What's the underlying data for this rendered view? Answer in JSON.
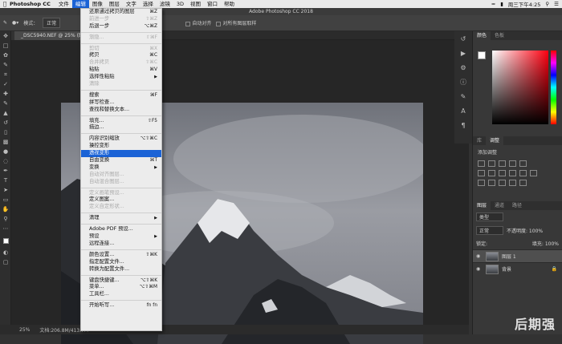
{
  "menubar": {
    "app": "Photoshop CC",
    "items": [
      "文件",
      "编辑",
      "图像",
      "图层",
      "文字",
      "选择",
      "滤镜",
      "3D",
      "视图",
      "窗口",
      "帮助"
    ],
    "active_index": 1,
    "clock": "周三下午4:25"
  },
  "titlebar": {
    "title": "Adobe Photoshop CC 2018"
  },
  "options": {
    "mode_label": "模式：",
    "mode_value": "正常",
    "align_label": "自动对齐",
    "sample_label": "对所有图层取样"
  },
  "doc_tab": {
    "label": "_DSC5940.NEF @ 25% (图层 1, RGB/8*)"
  },
  "status": {
    "zoom": "25%",
    "doc": "文档:206.8M/413.7M"
  },
  "edit_menu": [
    {
      "label": "还原通过拷贝的图层",
      "shortcut": "⌘Z",
      "enabled": true
    },
    {
      "label": "前进一步",
      "shortcut": "⇧⌘Z",
      "enabled": false
    },
    {
      "label": "后退一步",
      "shortcut": "⌥⌘Z",
      "enabled": true
    },
    {
      "sep": true
    },
    {
      "label": "渐隐...",
      "shortcut": "⇧⌘F",
      "enabled": false
    },
    {
      "sep": true
    },
    {
      "label": "剪切",
      "shortcut": "⌘X",
      "enabled": false
    },
    {
      "label": "拷贝",
      "shortcut": "⌘C",
      "enabled": true
    },
    {
      "label": "合并拷贝",
      "shortcut": "⇧⌘C",
      "enabled": false
    },
    {
      "label": "粘贴",
      "shortcut": "⌘V",
      "enabled": true
    },
    {
      "label": "选择性粘贴",
      "shortcut": "",
      "submenu": true,
      "enabled": true
    },
    {
      "label": "清除",
      "shortcut": "",
      "enabled": false
    },
    {
      "sep": true
    },
    {
      "label": "搜索",
      "shortcut": "⌘F",
      "enabled": true
    },
    {
      "label": "拼写检查...",
      "shortcut": "",
      "enabled": true
    },
    {
      "label": "查找和替换文本...",
      "shortcut": "",
      "enabled": true
    },
    {
      "sep": true
    },
    {
      "label": "填充...",
      "shortcut": "⇧F5",
      "enabled": true
    },
    {
      "label": "描边...",
      "shortcut": "",
      "enabled": true
    },
    {
      "sep": true
    },
    {
      "label": "内容识别缩放",
      "shortcut": "⌥⇧⌘C",
      "enabled": true
    },
    {
      "label": "操控变形",
      "shortcut": "",
      "enabled": true
    },
    {
      "label": "透视变形",
      "shortcut": "",
      "enabled": true,
      "highlight": true
    },
    {
      "label": "自由变换",
      "shortcut": "⌘T",
      "enabled": true
    },
    {
      "label": "变换",
      "shortcut": "",
      "submenu": true,
      "enabled": true
    },
    {
      "label": "自动对齐图层...",
      "shortcut": "",
      "enabled": false
    },
    {
      "label": "自动混合图层...",
      "shortcut": "",
      "enabled": false
    },
    {
      "sep": true
    },
    {
      "label": "定义画笔预设...",
      "shortcut": "",
      "enabled": false
    },
    {
      "label": "定义图案...",
      "shortcut": "",
      "enabled": true
    },
    {
      "label": "定义自定形状...",
      "shortcut": "",
      "enabled": false
    },
    {
      "sep": true
    },
    {
      "label": "清理",
      "shortcut": "",
      "submenu": true,
      "enabled": true
    },
    {
      "sep": true
    },
    {
      "label": "Adobe PDF 预设...",
      "shortcut": "",
      "enabled": true
    },
    {
      "label": "预设",
      "shortcut": "",
      "submenu": true,
      "enabled": true
    },
    {
      "label": "远程连接...",
      "shortcut": "",
      "enabled": true
    },
    {
      "sep": true
    },
    {
      "label": "颜色设置...",
      "shortcut": "⇧⌘K",
      "enabled": true
    },
    {
      "label": "指定配置文件...",
      "shortcut": "",
      "enabled": true
    },
    {
      "label": "转换为配置文件...",
      "shortcut": "",
      "enabled": true
    },
    {
      "sep": true
    },
    {
      "label": "键盘快捷键...",
      "shortcut": "⌥⇧⌘K",
      "enabled": true
    },
    {
      "label": "菜单...",
      "shortcut": "⌥⇧⌘M",
      "enabled": true
    },
    {
      "label": "工具栏...",
      "shortcut": "",
      "enabled": true
    },
    {
      "sep": true
    },
    {
      "label": "开始听写...",
      "shortcut": "fn fn",
      "enabled": true
    }
  ],
  "panels": {
    "color_tabs": [
      "颜色",
      "色板"
    ],
    "adj_tabs": [
      "库",
      "调整"
    ],
    "adj_label": "添加调整",
    "layer_tabs": [
      "图层",
      "通道",
      "路径"
    ],
    "kind_label": "类型",
    "blend_mode": "正常",
    "opacity": "不透明度: 100%",
    "lock_label": "锁定:",
    "fill": "填充: 100%",
    "layers": [
      {
        "name": "图层 1",
        "selected": true,
        "locked": false
      },
      {
        "name": "背景",
        "selected": false,
        "locked": true
      }
    ]
  },
  "watermark": "后期强"
}
